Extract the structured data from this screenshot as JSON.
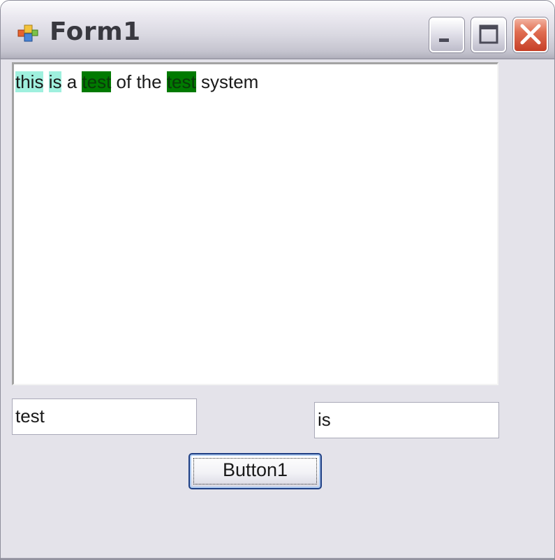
{
  "window": {
    "title": "Form1",
    "app_icon": "winforms-app-icon",
    "controls": [
      "minimize-icon",
      "maximize-icon",
      "close-icon"
    ]
  },
  "richtext": {
    "segments": [
      {
        "text": "this",
        "highlight": "#9ff0de"
      },
      {
        "text": " ",
        "highlight": null
      },
      {
        "text": "is",
        "highlight": "#9ff0de"
      },
      {
        "text": " a ",
        "highlight": null
      },
      {
        "text": "test",
        "highlight": "#007a00"
      },
      {
        "text": " of the ",
        "highlight": null
      },
      {
        "text": "test",
        "highlight": "#007a00"
      },
      {
        "text": " system",
        "highlight": null
      }
    ]
  },
  "inputs": {
    "left_value": "test",
    "right_value": "is"
  },
  "button": {
    "label": "Button1"
  },
  "colors": {
    "highlight_secondary": "#9ff0de",
    "highlight_primary": "#007a00",
    "close_button": "#e06e52"
  }
}
